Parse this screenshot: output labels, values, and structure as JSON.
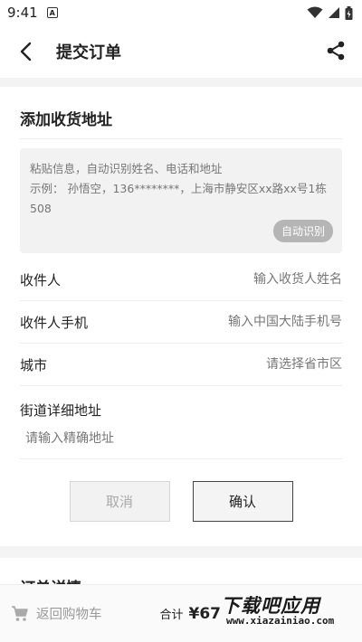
{
  "status_bar": {
    "time": "9:41",
    "notification_letter": "A"
  },
  "header": {
    "title": "提交订单"
  },
  "address_form": {
    "title": "添加收货地址",
    "paste_hint": "粘贴信息，自动识别姓名、电话和地址\n示例： 孙悟空，136********，上海市静安区xx路xx号1栋508",
    "auto_recognize_label": "自动识别",
    "fields": [
      {
        "label": "收件人",
        "placeholder": "输入收货人姓名"
      },
      {
        "label": "收件人手机",
        "placeholder": "输入中国大陆手机号"
      },
      {
        "label": "城市",
        "placeholder": "请选择省市区"
      }
    ],
    "street": {
      "label": "街道详细地址",
      "placeholder": "请输入精确地址"
    },
    "cancel_label": "取消",
    "confirm_label": "确认"
  },
  "order_details": {
    "title": "订单详情"
  },
  "bottom_bar": {
    "back_to_cart_label": "返回购物车",
    "total_label": "合计",
    "total_value": "¥67"
  },
  "watermark": {
    "main": "下载吧应用",
    "sub": "www.xiazainiao.com"
  },
  "colors": {
    "accent": "#222222",
    "muted": "#777777",
    "background_gray": "#f2f2f2"
  }
}
